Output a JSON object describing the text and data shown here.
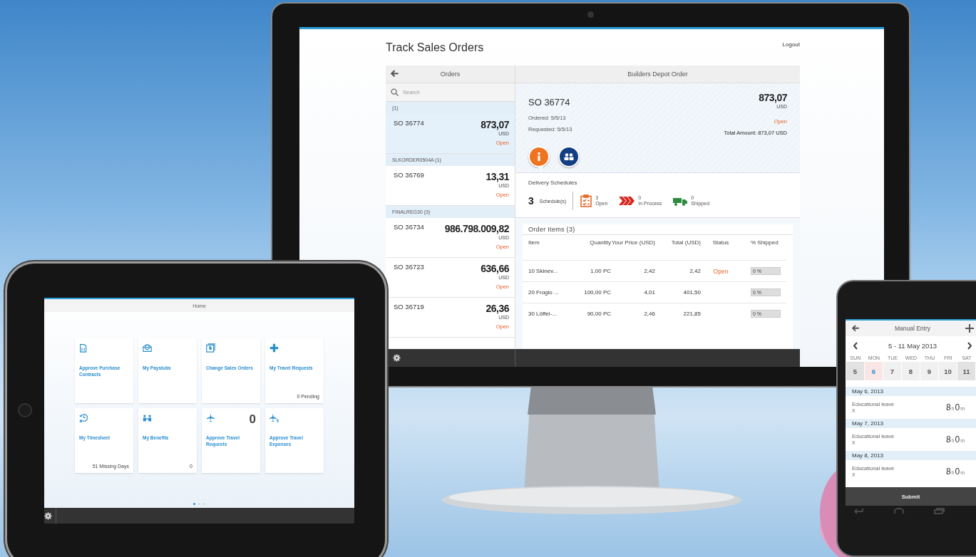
{
  "monitor_app": {
    "title": "Track Sales Orders",
    "logout": "Logout",
    "master": {
      "title": "Orders",
      "search_placeholder": "Search",
      "groups": [
        {
          "title": "(1)",
          "orders": [
            {
              "id": "SO 36774",
              "amount": "873,07",
              "currency": "USD",
              "status": "Open",
              "selected": true
            }
          ]
        },
        {
          "title": "SLKORDER0504A (1)",
          "orders": [
            {
              "id": "SO 36769",
              "amount": "13,31",
              "currency": "USD",
              "status": "Open",
              "selected": false
            }
          ]
        },
        {
          "title": "FINALREG30 (3)",
          "orders": [
            {
              "id": "SO 36734",
              "amount": "986.798.009,82",
              "currency": "USD",
              "status": "Open",
              "selected": false
            },
            {
              "id": "SO 36723",
              "amount": "636,66",
              "currency": "USD",
              "status": "Open",
              "selected": false
            },
            {
              "id": "SO 36719",
              "amount": "26,36",
              "currency": "USD",
              "status": "Open",
              "selected": false
            }
          ]
        }
      ]
    },
    "detail": {
      "title": "Builders Depot Order",
      "order_id": "SO 36774",
      "amount": "873,07",
      "currency": "USD",
      "ordered": "Ordered: 5/5/13",
      "requested": "Requested: 5/5/13",
      "status": "Open",
      "total": "Total Amount: 873,07 USD",
      "tabs": [
        {
          "kind": "info",
          "selected": true
        },
        {
          "kind": "contacts",
          "selected": false
        }
      ],
      "delivery": {
        "title": "Delivery Schedules",
        "count": "3",
        "count_label": "Schedule(s)",
        "stats": [
          {
            "kind": "open",
            "value": "3",
            "label": "Open"
          },
          {
            "kind": "in_process",
            "value": "0",
            "label": "In Process"
          },
          {
            "kind": "shipped",
            "value": "0",
            "label": "Shipped"
          }
        ]
      },
      "items": {
        "title": "Order Items (3)",
        "columns": [
          "Item",
          "Quantity",
          "Your Price (USD)",
          "Total (USD)",
          "Status",
          "% Shipped"
        ],
        "rows": [
          {
            "item": "10 Skinev...",
            "quantity": "1,00 PC",
            "price": "2,42",
            "total": "2,42",
            "status": "Open",
            "shipped": "0 %",
            "level": 0
          },
          {
            "item": "20 Froglo ...",
            "quantity": "100,00 PC",
            "price": "4,01",
            "total": "401,50",
            "shipped": "0 %",
            "level": 0
          },
          {
            "item": "30 Löffel-...",
            "quantity": "90,00 PC",
            "price": "2,46",
            "total": "221,85",
            "shipped": "0 %",
            "level": 0
          }
        ]
      }
    }
  },
  "tablet_app": {
    "title": "Home",
    "tiles": [
      {
        "kind": "contract",
        "title": "Approve Purchase Contracts"
      },
      {
        "kind": "paystub",
        "title": "My Paystubs"
      },
      {
        "kind": "sales_order",
        "title": "Change Sales Orders"
      },
      {
        "kind": "travel_request",
        "title": "My Travel Requests",
        "info": "0 Pending"
      },
      {
        "kind": "timesheet",
        "title": "My Timesheet",
        "info": "51 Missing Days"
      },
      {
        "kind": "benefits",
        "title": "My Benefits",
        "info": "0"
      },
      {
        "kind": "approve_travel",
        "title": "Approve Travel Requests",
        "number": "0"
      },
      {
        "kind": "travel_expense",
        "title": "Approve Travel Expenses"
      }
    ],
    "pages": [
      {
        "selected": true
      },
      {
        "selected": false
      },
      {
        "selected": false
      }
    ]
  },
  "phone_app": {
    "title": "Manual Entry",
    "week": "5 - 11 May 2013",
    "days": [
      {
        "weekday": "SUN",
        "date": "5",
        "selected": false,
        "weekend": true
      },
      {
        "weekday": "MON",
        "date": "6",
        "selected": true,
        "weekend": false
      },
      {
        "weekday": "TUE",
        "date": "7",
        "selected": false,
        "weekend": false
      },
      {
        "weekday": "WED",
        "date": "8",
        "selected": false,
        "weekend": false
      },
      {
        "weekday": "THU",
        "date": "9",
        "selected": false,
        "weekend": false
      },
      {
        "weekday": "FRI",
        "date": "10",
        "selected": false,
        "weekend": false
      },
      {
        "weekday": "SAT",
        "date": "11",
        "selected": false,
        "weekend": true
      }
    ],
    "entries": [
      {
        "date": "May 6, 2013",
        "type": "Educational leave",
        "code": "X",
        "hours": "8",
        "hour_unit": "h",
        "minutes": "0",
        "minute_unit": "m"
      },
      {
        "date": "May 7, 2013",
        "type": "Educational leave",
        "code": "X",
        "hours": "8",
        "hour_unit": "h",
        "minutes": "0",
        "minute_unit": "m"
      },
      {
        "date": "May 8, 2013",
        "type": "Educational leave",
        "code": "X",
        "hours": "8",
        "hour_unit": "h",
        "minutes": "0",
        "minute_unit": "m"
      }
    ],
    "submit": "Submit"
  }
}
